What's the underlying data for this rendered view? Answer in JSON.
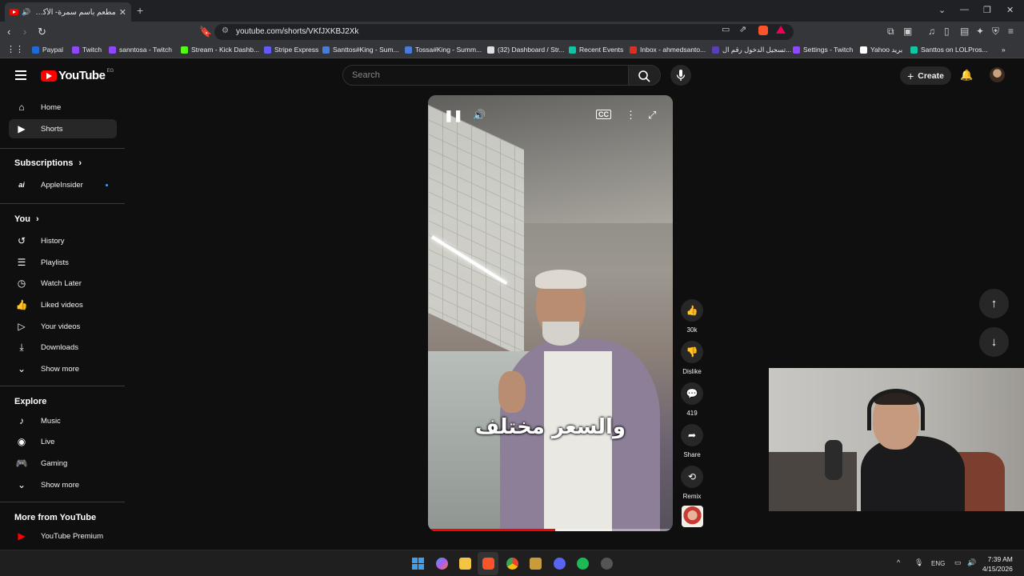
{
  "browser": {
    "tab_title": "مطعم باسم سمرة- الأكلة دي كـ",
    "url": "youtube.com/shorts/VKfJXKBJ2Xk",
    "bookmarks": [
      {
        "label": "Paypal",
        "color": "#1e6ad6"
      },
      {
        "label": "Twitch",
        "color": "#9146ff"
      },
      {
        "label": "sanntosa - Twitch",
        "color": "#9146ff"
      },
      {
        "label": "Stream - Kick Dashb...",
        "color": "#53fc18"
      },
      {
        "label": "Stripe Express",
        "color": "#635bff"
      },
      {
        "label": "Santtos#King - Sum...",
        "color": "#4a7bd6"
      },
      {
        "label": "Tossa#King - Summ...",
        "color": "#4a7bd6"
      },
      {
        "label": "(32) Dashboard / Str...",
        "color": "#e0e0e0"
      },
      {
        "label": "Recent Events",
        "color": "#13c4a3"
      },
      {
        "label": "Inbox - ahmedsanto...",
        "color": "#d93025"
      },
      {
        "label": "تسجيل الدخول رقم ال...",
        "color": "#5a3fb2"
      },
      {
        "label": "Settings - Twitch",
        "color": "#9146ff"
      },
      {
        "label": "Yahoo بريد",
        "color": "#ffffff"
      },
      {
        "label": "Santtos on LOLPros...",
        "color": "#13c4a3"
      }
    ]
  },
  "header": {
    "logo_text": "YouTube",
    "region": "EG",
    "search_placeholder": "Search",
    "create_label": "Create"
  },
  "sidebar": {
    "main": [
      {
        "label": "Home",
        "icon": "home-icon"
      },
      {
        "label": "Shorts",
        "icon": "shorts-icon"
      }
    ],
    "subscriptions_heading": "Subscriptions",
    "subscriptions": [
      {
        "label": "AppleInsider",
        "icon": "ai-icon"
      }
    ],
    "you_heading": "You",
    "you": [
      {
        "label": "History",
        "icon": "history-icon"
      },
      {
        "label": "Playlists",
        "icon": "playlists-icon"
      },
      {
        "label": "Watch Later",
        "icon": "clock-icon"
      },
      {
        "label": "Liked videos",
        "icon": "thumbs-up-icon"
      },
      {
        "label": "Your videos",
        "icon": "video-icon"
      },
      {
        "label": "Downloads",
        "icon": "download-icon"
      },
      {
        "label": "Show more",
        "icon": "chevron-down-icon"
      }
    ],
    "explore_heading": "Explore",
    "explore": [
      {
        "label": "Music",
        "icon": "music-icon"
      },
      {
        "label": "Live",
        "icon": "live-icon"
      },
      {
        "label": "Gaming",
        "icon": "gaming-icon"
      },
      {
        "label": "Show more",
        "icon": "chevron-down-icon"
      }
    ],
    "more_heading": "More from YouTube",
    "more": [
      {
        "label": "YouTube Premium",
        "icon": "youtube-premium-icon"
      }
    ]
  },
  "video": {
    "caption": "والسعر مختلف",
    "progress": 0.52
  },
  "actions": {
    "like_count": "30k",
    "dislike_label": "Dislike",
    "comment_count": "419",
    "share_label": "Share",
    "remix_label": "Remix"
  },
  "taskbar": {
    "lang": "ENG",
    "time": "7:39 AM",
    "date": "4/15/2026"
  }
}
